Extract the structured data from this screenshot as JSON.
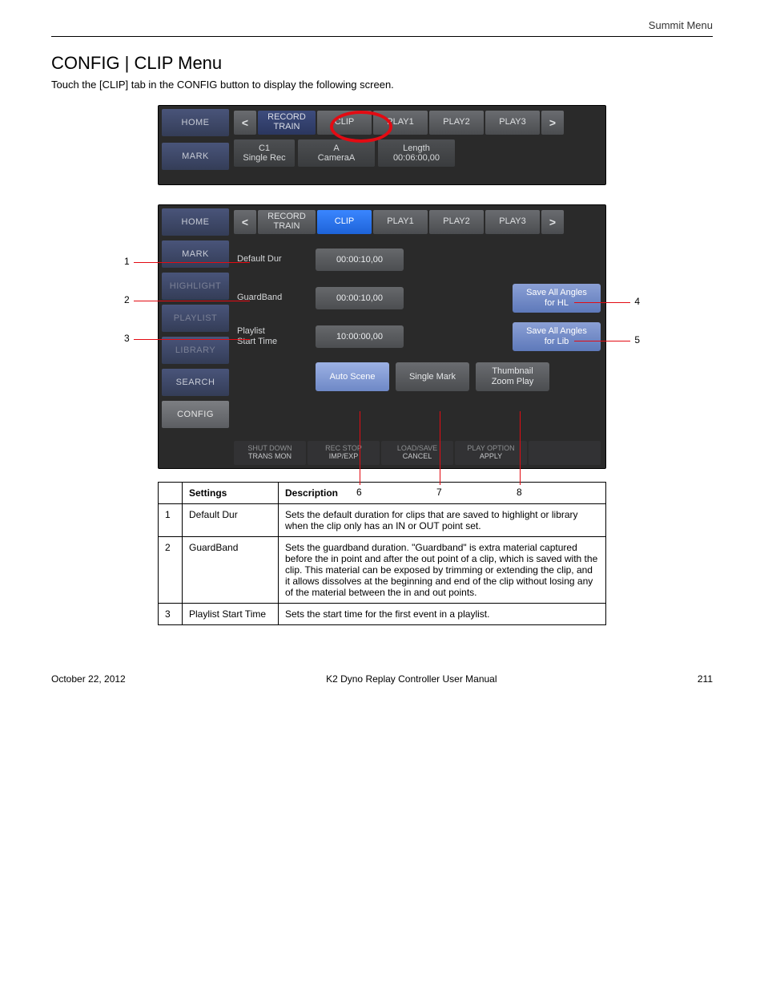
{
  "header": {
    "right": "Summit Menu"
  },
  "title": "CONFIG | CLIP Menu",
  "subtitle": "Touch the [CLIP] tab in the CONFIG button to display the following screen.",
  "panel1": {
    "side": [
      "HOME",
      "MARK"
    ],
    "tabs": {
      "prev": "<",
      "items": [
        "RECORD\nTRAIN",
        "CLIP",
        "PLAY1",
        "PLAY2",
        "PLAY3"
      ],
      "next": ">",
      "activeLike": "HOME_SELECTED"
    },
    "sub": {
      "a": {
        "l1": "C1",
        "l2": "Single Rec"
      },
      "b": {
        "l1": "A",
        "l2": "CameraA"
      },
      "c": {
        "l1": "Length",
        "l2": "00:06:00,00"
      }
    }
  },
  "panel2": {
    "side": [
      "HOME",
      "MARK",
      "HIGHLIGHT",
      "PLAYLIST",
      "LIBRARY",
      "SEARCH",
      "CONFIG"
    ],
    "tabs": {
      "prev": "<",
      "items": [
        "RECORD\nTRAIN",
        "CLIP",
        "PLAY1",
        "PLAY2",
        "PLAY3"
      ],
      "next": ">"
    },
    "rows": {
      "r1": {
        "label": "Default Dur",
        "value": "00:00:10,00"
      },
      "r2": {
        "label": "GuardBand",
        "value": "00:00:10,00",
        "right": "Save All Angles\nfor HL"
      },
      "r3": {
        "label": "Playlist\nStart Time",
        "value": "10:00:00,00",
        "right": "Save All Angles\nfor Lib"
      },
      "r4": {
        "b1": "Auto Scene",
        "b2": "Single Mark",
        "b3": "Thumbnail\nZoom Play"
      }
    },
    "bottom": [
      {
        "t": "SHUT DOWN",
        "b": "TRANS MON"
      },
      {
        "t": "REC STOP",
        "b": "IMP/EXP"
      },
      {
        "t": "LOAD/SAVE",
        "b": "CANCEL"
      },
      {
        "t": "PLAY OPTION",
        "b": "APPLY"
      },
      {
        "t": "",
        "b": ""
      }
    ]
  },
  "callouts": [
    "1",
    "2",
    "3",
    "4",
    "5",
    "6",
    "7",
    "8"
  ],
  "table": {
    "head": [
      "",
      "Settings",
      "Description"
    ],
    "rows": [
      {
        "n": "1",
        "s": "Default Dur",
        "d": "Sets the default duration for clips that are saved to highlight or library when the clip only has an IN or OUT point set."
      },
      {
        "n": "2",
        "s": "GuardBand",
        "d": "Sets the guardband duration. \"Guardband\" is extra material captured before the in point and after the out point of a clip, which is saved with the clip. This material can be exposed by trimming or extending the clip, and it allows dissolves at the beginning and end of the clip without losing any of the material between the in and out points."
      },
      {
        "n": "3",
        "s": "Playlist Start Time",
        "d": "Sets the start time for the first event in a playlist."
      }
    ]
  },
  "footer": {
    "left": "October 22, 2012",
    "center": "K2 Dyno Replay Controller User Manual",
    "right": "211"
  }
}
